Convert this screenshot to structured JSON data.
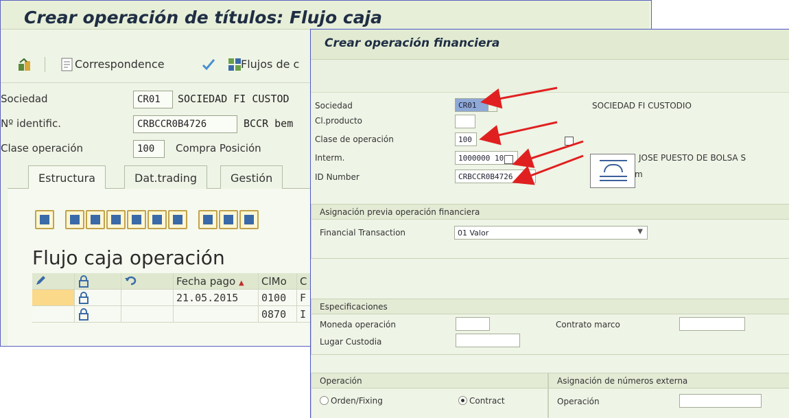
{
  "back_window": {
    "title": "Crear operación de títulos: Flujo caja",
    "toolbar": {
      "correspondence": "Correspondence",
      "flujos": "Flujos de c"
    },
    "fields": {
      "sociedad_label": "Sociedad",
      "sociedad_code": "CR01",
      "sociedad_name": "SOCIEDAD FI CUSTOD",
      "identific_label": "Nº identific.",
      "identific_value": "CRBCCR0B4726",
      "identific_desc": "BCCR bem",
      "clase_label": "Clase operación",
      "clase_code": "100",
      "clase_desc": "Compra Posición"
    },
    "tabs": [
      "Estructura",
      "Dat.trading",
      "Gestión"
    ],
    "grid": {
      "title": "Flujo caja operación",
      "headers": [
        "Fecha pago",
        "ClMo",
        "C"
      ],
      "rows": [
        {
          "fecha": "21.05.2015",
          "clmo": "0100",
          "c": "F"
        },
        {
          "fecha": "",
          "clmo": "0870",
          "c": "I"
        }
      ]
    }
  },
  "popup": {
    "title": "Crear operación financiera",
    "fields": {
      "sociedad_label": "Sociedad",
      "sociedad_value": "CR01",
      "sociedad_name": "SOCIEDAD FI CUSTODIO",
      "clproducto_label": "Cl.producto",
      "clase_label": "Clase de operación",
      "clase_value": "100",
      "interm_label": "Interm.",
      "interm_value": "1000000 10",
      "interm_name": "JOSE PUESTO DE BOLSA S",
      "interm_extra": "m",
      "id_label": "ID Number",
      "id_value": "CRBCCR0B4726"
    },
    "asignacion": {
      "header": "Asignación previa operación financiera",
      "label": "Financial Transaction",
      "value": "01 Valor"
    },
    "especificaciones": {
      "header": "Especificaciones",
      "moneda_label": "Moneda operación",
      "contrato_label": "Contrato marco",
      "lugar_label": "Lugar Custodia"
    },
    "operacion": {
      "header": "Operación",
      "option1": "Orden/Fixing",
      "option2": "Contract",
      "selected": "Contract"
    },
    "asignacion_externa": {
      "header": "Asignación de números externa",
      "label": "Operación"
    }
  },
  "colors": {
    "sap_background": "#eef4e6",
    "annotation_arrow": "#e02020",
    "window_border": "#4d55c8"
  }
}
